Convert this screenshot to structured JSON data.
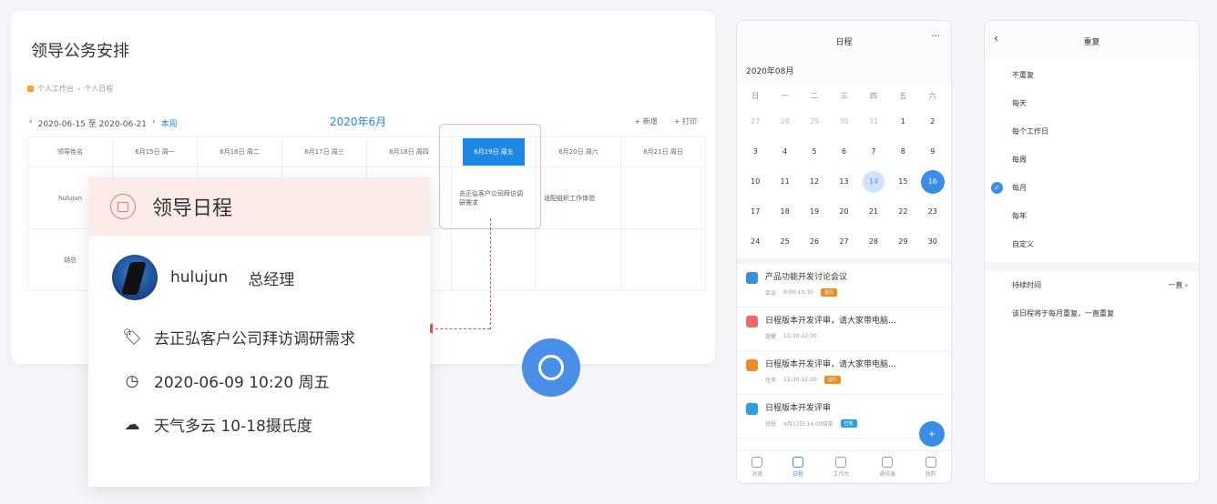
{
  "web": {
    "title": "领导公务安排",
    "breadcrumb": [
      "个人工作台",
      "个人日程"
    ],
    "range": "2020-06-15 至 2020-06-21",
    "this_week": "本周",
    "month": "2020年6月",
    "actions": [
      "+ 新增",
      "+ 打印"
    ],
    "headers": [
      "领导姓名",
      "6月15日 周一",
      "6月16日 周二",
      "6月17日 周三",
      "6月18日 周四",
      "6月19日 周五",
      "6月20日 周六",
      "6月21日 周日"
    ],
    "rows": [
      {
        "name": "hulujun",
        "events": [
          "",
          "",
          "",
          "",
          "去正弘客户公司拜访调研需求",
          "适配组织工作体验",
          ""
        ]
      },
      {
        "name": "胡总",
        "events": [
          "",
          "",
          "",
          "",
          "",
          "",
          ""
        ]
      }
    ]
  },
  "popup": {
    "title": "领导日程",
    "user": "hulujun",
    "role": "总经理",
    "task": "去正弘客户公司拜访调研需求",
    "time": "2020-06-09  10:20 周五",
    "weather": "天气多云  10-18摄氏度"
  },
  "mobile_calendar": {
    "title": "日程",
    "more": "···",
    "month": "2020年08月",
    "weekdays": [
      "日",
      "一",
      "二",
      "三",
      "四",
      "五",
      "六"
    ],
    "days": [
      "27",
      "28",
      "29",
      "30",
      "31",
      "1",
      "2",
      "3",
      "4",
      "5",
      "6",
      "7",
      "8",
      "9",
      "10",
      "11",
      "12",
      "13",
      "14",
      "15",
      "16",
      "17",
      "18",
      "19",
      "20",
      "21",
      "22",
      "23",
      "24",
      "25",
      "26",
      "27",
      "28",
      "29",
      "30"
    ],
    "events": [
      {
        "title": "产品功能开发讨论会议",
        "type": "会议",
        "time": "9:00-10:30",
        "tag": "进行",
        "color": "#3a8ee6",
        "tagcolor": "#f08a24"
      },
      {
        "title": "日程版本开发评审，请大家带电脑…",
        "type": "提醒",
        "time": "11:30-12:00",
        "tag": "",
        "color": "#f06a6a",
        "tagcolor": ""
      },
      {
        "title": "日程版本开发评审，请大家带电脑…",
        "type": "任务",
        "time": "11:30-12:00",
        "tag": "进行",
        "color": "#f08a24",
        "tagcolor": "#f08a24"
      },
      {
        "title": "日程版本开发评审",
        "type": "日程",
        "time": "4月17日 14:00结束",
        "tag": "已完",
        "color": "#2aa0e0",
        "tagcolor": "#2aa0e0"
      }
    ],
    "fab": "+",
    "tabs": [
      "消息",
      "日程",
      "工作台",
      "通讯录",
      "我的"
    ]
  },
  "mobile_repeat": {
    "title": "重复",
    "back": "‹",
    "options": [
      "不重复",
      "每天",
      "每个工作日",
      "每周",
      "每月",
      "每年",
      "自定义"
    ],
    "selected": "每月",
    "duration_label": "持续时间",
    "duration_value": "一直 ›",
    "summary": "该日程将于每月重复，一直重复"
  }
}
